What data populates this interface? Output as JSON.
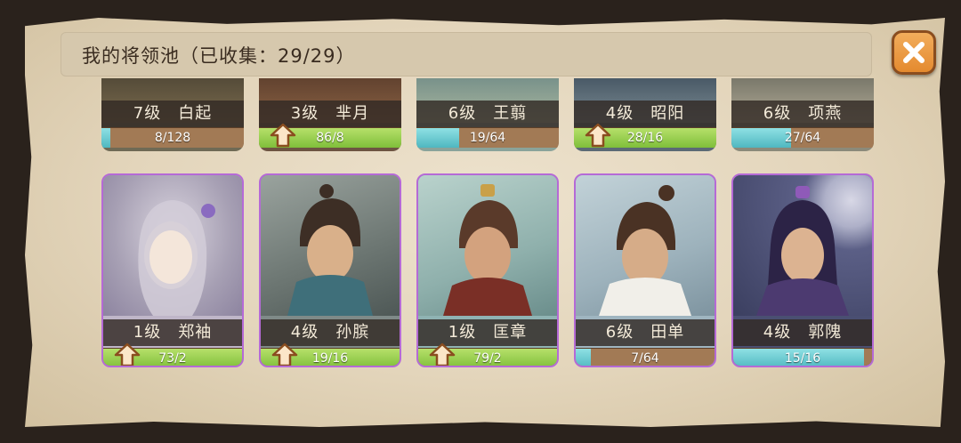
{
  "panel": {
    "title": "我的将领池（已收集：29/29）"
  },
  "bar_fill": {
    "max_color": "#7fbf3a",
    "progress_color": "#4fb7c0",
    "empty_color": "#a27a55"
  },
  "top_row": [
    {
      "name": "7级　白起",
      "progress": "8/128",
      "upgrade": false,
      "fill_fraction": 0.06
    },
    {
      "name": "3级　芈月",
      "progress": "86/8",
      "upgrade": true,
      "fill_fraction": 1.0
    },
    {
      "name": "6级　王翦",
      "progress": "19/64",
      "upgrade": false,
      "fill_fraction": 0.3
    },
    {
      "name": "4级　昭阳",
      "progress": "28/16",
      "upgrade": true,
      "fill_fraction": 1.0
    },
    {
      "name": "6级　项燕",
      "progress": "27/64",
      "upgrade": false,
      "fill_fraction": 0.42
    }
  ],
  "bottom_row": [
    {
      "name": "1级　郑袖",
      "progress": "73/2",
      "upgrade": true,
      "fill_fraction": 1.0,
      "border": "#b56ad6",
      "bg": "#bfb6c8"
    },
    {
      "name": "4级　孙膑",
      "progress": "19/16",
      "upgrade": true,
      "fill_fraction": 1.0,
      "border": "#b56ad6",
      "bg": "#7f8a88"
    },
    {
      "name": "1级　匡章",
      "progress": "79/2",
      "upgrade": true,
      "fill_fraction": 1.0,
      "border": "#b56ad6",
      "bg": "#8fb3b3"
    },
    {
      "name": "6级　田单",
      "progress": "7/64",
      "upgrade": false,
      "fill_fraction": 0.11,
      "border": "#b56ad6",
      "bg": "#9fb5c0"
    },
    {
      "name": "4级　郭隗",
      "progress": "15/16",
      "upgrade": false,
      "fill_fraction": 0.94,
      "border": "#b56ad6",
      "bg": "#4a4f72"
    }
  ]
}
